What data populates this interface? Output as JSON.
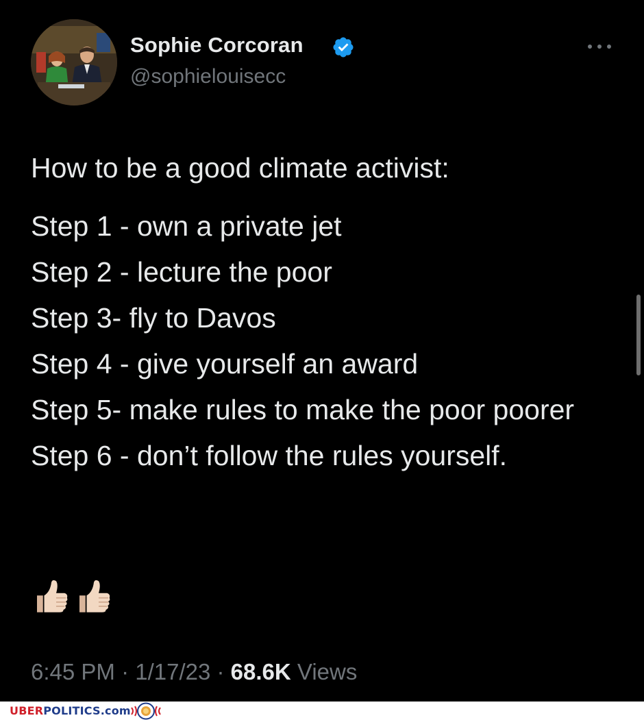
{
  "profile": {
    "display_name": "Sophie Corcoran",
    "handle": "@sophielouisecc",
    "verified": true,
    "avatar_icon": "profile-photo",
    "verified_icon": "verified-badge-icon",
    "more_icon": "more-options-icon"
  },
  "tweet": {
    "headline": "How to be a good climate activist:",
    "steps": [
      "Step 1 - own a private jet",
      "Step 2 - lecture the poor",
      "Step 3- fly to Davos",
      "Step 4 - give yourself an award",
      "Step 5- make rules to make the poor poorer",
      "Step 6 - don’t follow the rules yourself."
    ],
    "emojis": [
      "thumbs-up-icon",
      "thumbs-up-icon"
    ]
  },
  "meta": {
    "time": "6:45 PM",
    "date": "1/17/23",
    "separator": " · ",
    "views_count": "68.6K",
    "views_label": "Views"
  },
  "watermark": {
    "brand_prefix": "UBER",
    "brand_suffix": "POLITICS.com",
    "logo_icon": "lion-crest-icon"
  },
  "colors": {
    "background": "#000000",
    "primary_text": "#e7e9ea",
    "secondary_text": "#71767b",
    "verified_blue": "#1d9bf0",
    "brand_red": "#d0202a",
    "brand_blue": "#1f3c8a"
  }
}
